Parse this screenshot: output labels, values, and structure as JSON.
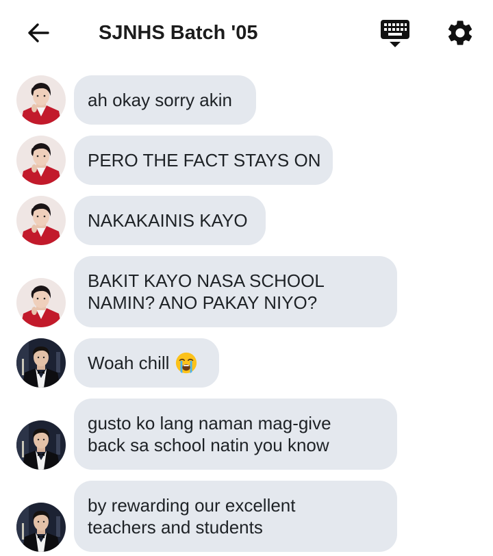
{
  "header": {
    "title": "SJNHS Batch '05",
    "back_icon": "arrow-left-icon",
    "keyboard_icon": "keyboard-icon",
    "settings_icon": "gear-icon"
  },
  "messages": [
    {
      "sender_avatar": "avatar-red-suit",
      "lines": [
        "ah okay sorry akin"
      ]
    },
    {
      "sender_avatar": "avatar-red-suit",
      "lines": [
        "PERO THE FACT STAYS ON"
      ]
    },
    {
      "sender_avatar": "avatar-red-suit",
      "lines": [
        "NAKAKAINIS KAYO"
      ]
    },
    {
      "sender_avatar": "avatar-red-suit",
      "lines": [
        "BAKIT KAYO NASA SCHOOL",
        "NAMIN? ANO PAKAY NIYO?"
      ]
    },
    {
      "sender_avatar": "avatar-tuxedo",
      "lines": [
        "Woah chill"
      ],
      "emoji": "loudly-crying-face-emoji"
    },
    {
      "sender_avatar": "avatar-tuxedo",
      "lines": [
        "gusto ko lang naman mag-give",
        "back sa school natin you know"
      ]
    },
    {
      "sender_avatar": "avatar-tuxedo",
      "lines": [
        "by rewarding our excellent",
        "teachers and students"
      ]
    }
  ],
  "colors": {
    "bubble_bg": "#e4e8ee",
    "text": "#1e2226",
    "red_suit": "#c21a2b",
    "tuxedo_bg": "#1c2233"
  }
}
